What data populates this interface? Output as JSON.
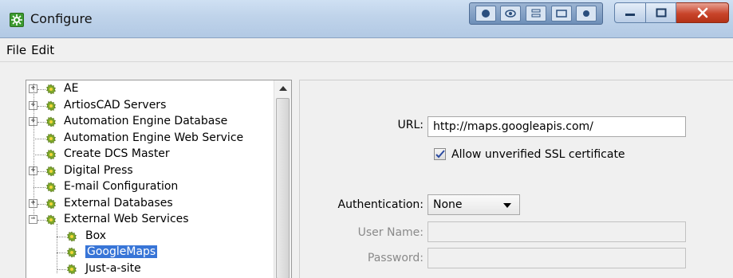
{
  "window": {
    "title": "Configure",
    "controls": {
      "minimize": "minimize",
      "maximize": "maximize",
      "close": "close"
    }
  },
  "toolbar": {
    "icons": [
      "record-icon",
      "eye-icon",
      "stack-icon",
      "panel-icon",
      "dot-icon"
    ]
  },
  "menu": {
    "items": [
      "File",
      "Edit"
    ]
  },
  "tree": {
    "items": [
      {
        "label": "AE",
        "level": 0,
        "expander": "+"
      },
      {
        "label": "ArtiosCAD Servers",
        "level": 0,
        "expander": "+"
      },
      {
        "label": "Automation Engine Database",
        "level": 0,
        "expander": "+"
      },
      {
        "label": "Automation Engine Web Service",
        "level": 0,
        "expander": ""
      },
      {
        "label": "Create DCS Master",
        "level": 0,
        "expander": ""
      },
      {
        "label": "Digital Press",
        "level": 0,
        "expander": "+"
      },
      {
        "label": "E-mail Configuration",
        "level": 0,
        "expander": ""
      },
      {
        "label": "External Databases",
        "level": 0,
        "expander": "+"
      },
      {
        "label": "External Web Services",
        "level": 0,
        "expander": "−"
      },
      {
        "label": "Box",
        "level": 1,
        "expander": ""
      },
      {
        "label": "GoogleMaps",
        "level": 1,
        "expander": "",
        "selected": true
      },
      {
        "label": "Just-a-site",
        "level": 1,
        "expander": ""
      }
    ],
    "icon": "gear-icon",
    "accent_color": "#3875d7"
  },
  "form": {
    "url_label": "URL:",
    "url_value": "http://maps.googleapis.com/",
    "ssl_label": "Allow unverified SSL certificate",
    "ssl_checked": true,
    "auth_label": "Authentication:",
    "auth_value": "None",
    "username_label": "User Name:",
    "username_value": "",
    "password_label": "Password:",
    "password_value": ""
  }
}
